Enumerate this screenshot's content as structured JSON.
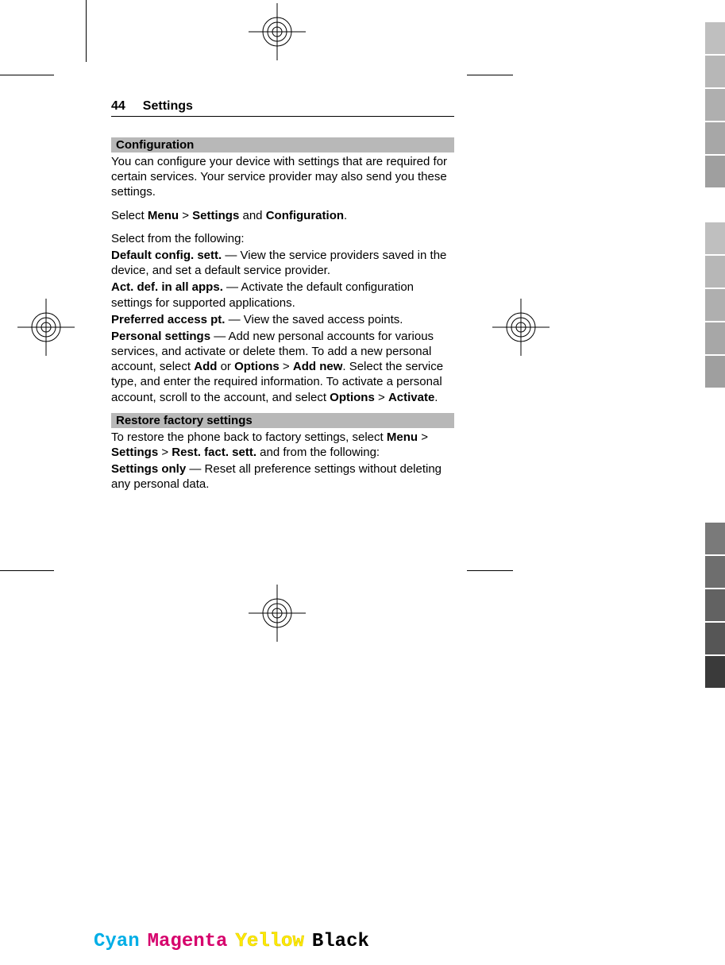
{
  "header": {
    "page_number": "44",
    "page_title": "Settings"
  },
  "sections": [
    {
      "bar": "Configuration",
      "paras": [
        {
          "html": "You can configure your device with settings that are required for certain services. Your service provider may also send you these settings."
        },
        {
          "html": "Select <b>Menu</b> > <b>Settings</b> and <b>Configuration</b>."
        },
        {
          "html": "Select from the following:",
          "mb": "2px"
        },
        {
          "html": "<b>Default config. sett.</b>  — View the service providers saved in the device, and set a default service provider.",
          "mb": "2px"
        },
        {
          "html": "<b>Act. def. in all apps.</b>  — Activate the default configuration settings for supported applications.",
          "mb": "2px"
        },
        {
          "html": "<b>Preferred access pt.</b>  — View the saved access points.",
          "mb": "2px"
        },
        {
          "html": "<b>Personal settings</b>  — Add new personal accounts for various services, and activate or delete them. To add a new personal account, select <b>Add</b> or <b>Options</b> > <b>Add new</b>. Select the service type, and enter the required information. To activate a personal account, scroll to the account, and select <b>Options</b> > <b>Activate</b>."
        }
      ]
    },
    {
      "bar": "Restore factory settings",
      "paras": [
        {
          "html": "To restore the phone back to factory settings, select <b>Menu</b> > <b>Settings</b> > <b>Rest. fact. sett.</b> and from the following:",
          "mb": "2px"
        },
        {
          "html": "<b>Settings only</b>  — Reset all preference settings without deleting any personal data."
        }
      ]
    }
  ],
  "colorbar": {
    "cyan": "Cyan",
    "magenta": "Magenta",
    "yellow": "Yellow",
    "black": "Black"
  },
  "thumb_tabs": [
    "#bfbfbf",
    "#b7b7b7",
    "#afafaf",
    "#a7a7a7",
    "#9f9f9f",
    "",
    "#bfbfbf",
    "#b7b7b7",
    "#afafaf",
    "#a7a7a7",
    "#9f9f9f",
    "",
    "",
    "",
    "",
    "#7a7a7a",
    "#6e6e6e",
    "#626262",
    "#565656",
    "#3a3a3a"
  ]
}
